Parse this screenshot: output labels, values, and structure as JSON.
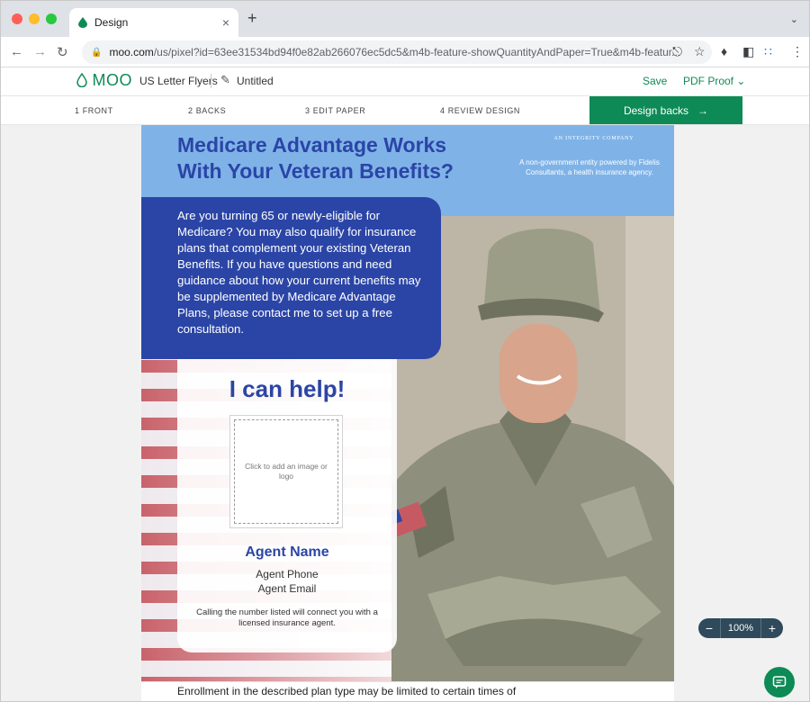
{
  "browser": {
    "tab_title": "Design",
    "tab_close": "×",
    "new_tab": "+",
    "url_host": "moo.com",
    "url_path": "/us/pixel?id=63ee31534bd94f0e82ab266076ec5dc5&m4b-feature-showQuantityAndPaper=True&m4b-featur..."
  },
  "header": {
    "logo": "MOO",
    "product": "US Letter Flyers",
    "doc_name": "Untitled",
    "save_label": "Save",
    "pdf_label": "PDF Proof"
  },
  "steps": {
    "items": [
      "1  FRONT",
      "2  BACKS",
      "3  EDIT PAPER",
      "4  REVIEW DESIGN"
    ],
    "cta_label": "Design backs",
    "cta_arrow": "→"
  },
  "flyer": {
    "headline_1": "Medicare Advantage Works",
    "headline_2": "With Your Veteran Benefits?",
    "brand_tagline": "AN INTEGRITY COMPANY",
    "brand_desc": "A non-government entity powered by Fidelis Consultants, a health insurance agency.",
    "intro": "Are you turning 65 or newly-eligible for Medicare? You may also qualify for insurance plans that complement your existing Veteran Benefits. If you have questions and need guidance about how your current benefits may be supplemented by Medicare Advantage Plans, please contact me to set up a free consultation.",
    "cta_heading": "I can help!",
    "image_placeholder": "Click to add an image or logo",
    "agent_name": "Agent Name",
    "agent_phone": "Agent Phone",
    "agent_email": "Agent Email",
    "calling_note": "Calling the number listed will connect you with a licensed insurance agent.",
    "bottom_text": "Enrollment in the described plan type may be limited to certain times of"
  },
  "zoom": {
    "minus": "−",
    "value": "100%",
    "plus": "+"
  },
  "colors": {
    "brand_green": "#0e8a56",
    "flyer_blue": "#2b45a6",
    "sky": "#7fb3e8"
  }
}
